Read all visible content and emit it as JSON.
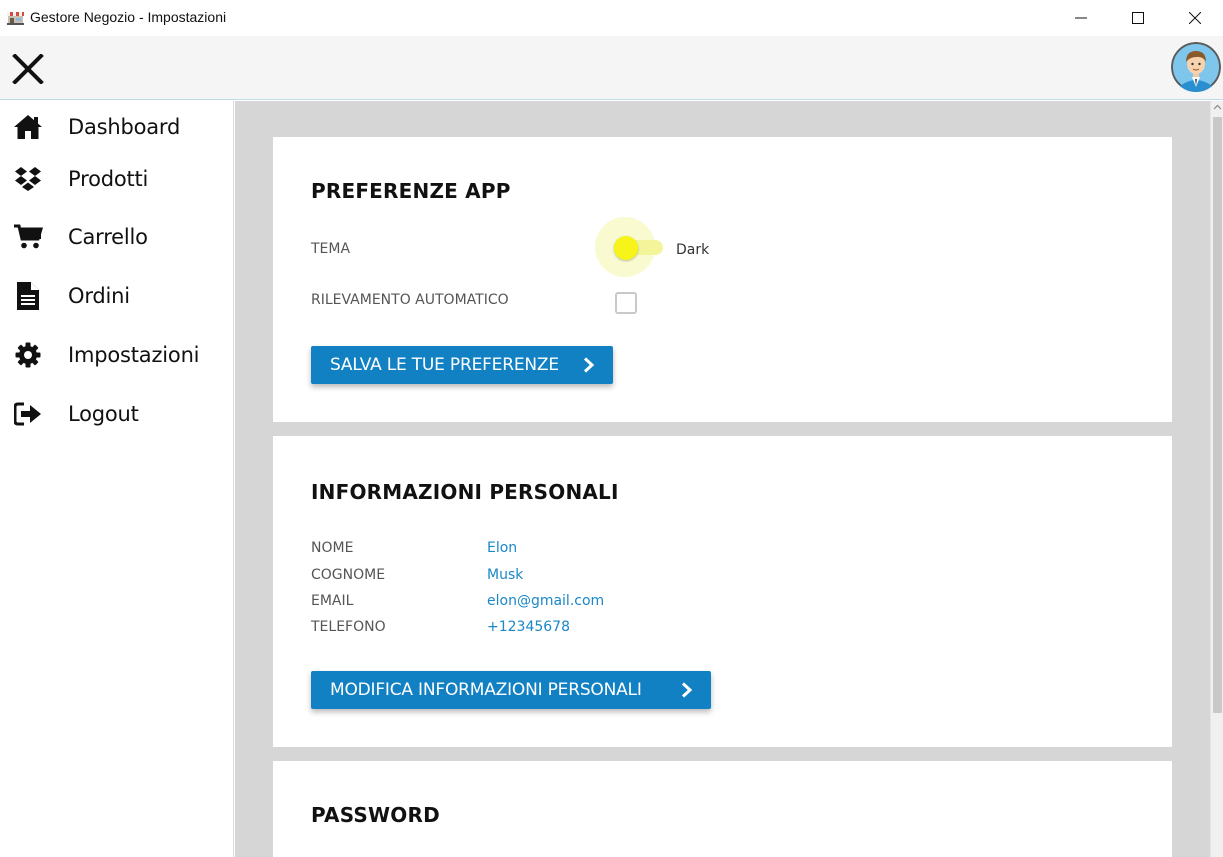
{
  "window": {
    "title": "Gestore Negozio - Impostazioni",
    "controls": [
      "minimize",
      "maximize",
      "close"
    ]
  },
  "header": {
    "menu_icon": "close-icon",
    "avatar_icon": "user-avatar"
  },
  "sidebar": {
    "items": [
      {
        "label": "Dashboard",
        "icon": "home-icon"
      },
      {
        "label": "Prodotti",
        "icon": "dropbox-icon"
      },
      {
        "label": "Carrello",
        "icon": "cart-icon"
      },
      {
        "label": "Ordini",
        "icon": "document-icon"
      },
      {
        "label": "Impostazioni",
        "icon": "gear-icon"
      },
      {
        "label": "Logout",
        "icon": "logout-icon"
      }
    ]
  },
  "preferences": {
    "title": "PREFERENZE APP",
    "theme_label": "TEMA",
    "theme_value": "Dark",
    "theme_enabled": true,
    "auto_detect_label": "RILEVAMENTO AUTOMATICO",
    "auto_detect_checked": false,
    "save_button": "SALVA LE TUE PREFERENZE"
  },
  "personal_info": {
    "title": "INFORMAZIONI PERSONALI",
    "fields": [
      {
        "label": "NOME",
        "value": "Elon"
      },
      {
        "label": "COGNOME",
        "value": "Musk"
      },
      {
        "label": "EMAIL",
        "value": "elon@gmail.com"
      },
      {
        "label": "TELEFONO",
        "value": "+12345678"
      }
    ],
    "edit_button": "MODIFICA INFORMAZIONI PERSONALI"
  },
  "password": {
    "title": "PASSWORD"
  },
  "colors": {
    "accent": "#1281c4",
    "link": "#1a87c8",
    "toggle_knob": "#f7f41a",
    "content_bg": "#d6d6d6"
  }
}
